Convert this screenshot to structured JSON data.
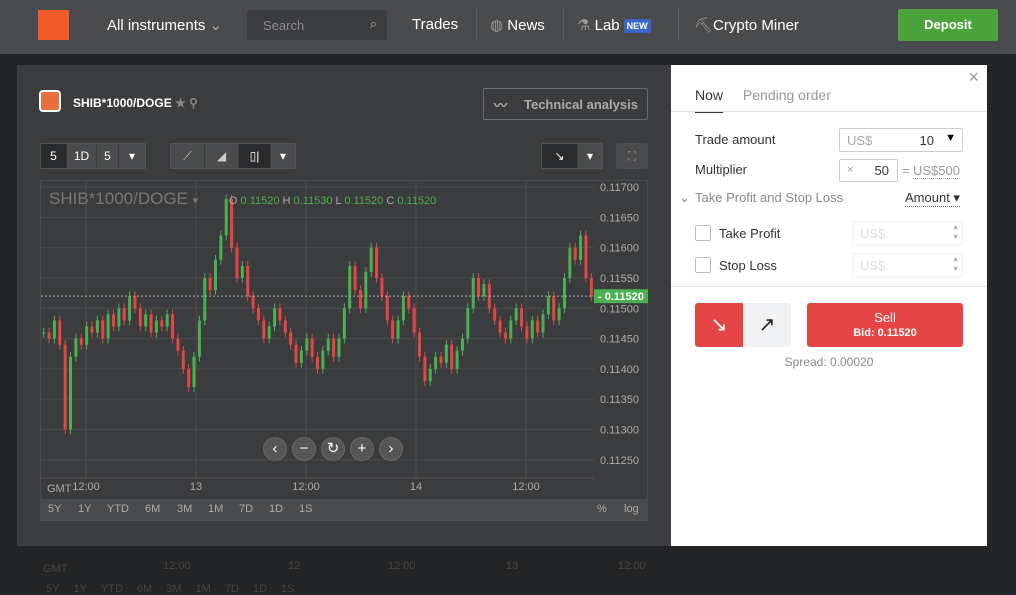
{
  "topbar": {
    "instruments": "All instruments",
    "search_placeholder": "Search",
    "trades": "Trades",
    "news": "News",
    "lab": "Lab",
    "lab_badge": "NEW",
    "crypto": "Crypto Miner",
    "deposit": "Deposit"
  },
  "background_axis": {
    "gmt": "GMT",
    "ticks": [
      "12:00",
      "12",
      "12:00",
      "13",
      "12:00"
    ],
    "ranges": [
      "5Y",
      "1Y",
      "YTD",
      "6M",
      "3M",
      "1M",
      "7D",
      "1D",
      "1S"
    ]
  },
  "chart_panel": {
    "symbol": "SHIB*1000/DOGE",
    "technical_analysis": "Technical analysis",
    "period_buttons": [
      "5",
      "1D",
      "5"
    ],
    "legend_symbol": "SHIB*1000/DOGE",
    "ohlc": {
      "O": "0.11520",
      "H": "0.11530",
      "L": "0.11520",
      "C": "0.11520"
    },
    "ranges": [
      "5Y",
      "1Y",
      "YTD",
      "6M",
      "3M",
      "1M",
      "7D",
      "1D",
      "1S"
    ],
    "percent": "%",
    "log": "log",
    "gmt": "GMT"
  },
  "chart_data": {
    "type": "candlestick",
    "ylim": [
      0.1122,
      0.1171
    ],
    "yticks": [
      "0.11700",
      "0.11650",
      "0.11600",
      "0.11550",
      "0.11500",
      "0.11450",
      "0.11400",
      "0.11350",
      "0.11300",
      "0.11250"
    ],
    "ytick_values": [
      0.117,
      0.1165,
      0.116,
      0.1155,
      0.115,
      0.1145,
      0.114,
      0.1135,
      0.113,
      0.1125
    ],
    "xticks": [
      "12:00",
      "13",
      "12:00",
      "14",
      "12:00"
    ],
    "current_price": "0.11520",
    "current_value": 0.1152,
    "closes": [
      0.1146,
      0.1145,
      0.1148,
      0.1144,
      0.113,
      0.1142,
      0.1145,
      0.1144,
      0.1147,
      0.1146,
      0.1148,
      0.1145,
      0.1149,
      0.1147,
      0.115,
      0.1148,
      0.1152,
      0.115,
      0.1147,
      0.1149,
      0.1146,
      0.1148,
      0.1147,
      0.1149,
      0.1145,
      0.1143,
      0.114,
      0.1137,
      0.1142,
      0.1148,
      0.1155,
      0.1153,
      0.1158,
      0.1162,
      0.1168,
      0.116,
      0.1155,
      0.1157,
      0.1152,
      0.115,
      0.1148,
      0.1145,
      0.1147,
      0.115,
      0.1148,
      0.1146,
      0.1144,
      0.1141,
      0.1143,
      0.1145,
      0.1142,
      0.114,
      0.1143,
      0.1145,
      0.1142,
      0.1145,
      0.115,
      0.1157,
      0.1153,
      0.115,
      0.1156,
      0.116,
      0.1155,
      0.1152,
      0.1148,
      0.1145,
      0.1148,
      0.1152,
      0.115,
      0.1146,
      0.1142,
      0.1138,
      0.114,
      0.1142,
      0.1141,
      0.1144,
      0.114,
      0.1143,
      0.1145,
      0.115,
      0.1155,
      0.1152,
      0.1154,
      0.115,
      0.1148,
      0.1146,
      0.1145,
      0.1148,
      0.115,
      0.1147,
      0.1145,
      0.1148,
      0.1146,
      0.1149,
      0.1152,
      0.1148,
      0.115,
      0.1155,
      0.116,
      0.1158,
      0.1162,
      0.1155,
      0.1152
    ]
  },
  "trade": {
    "tab_now": "Now",
    "tab_pending": "Pending order",
    "amount_label": "Trade amount",
    "amount_currency": "US$",
    "amount_value": "10",
    "multiplier_label": "Multiplier",
    "multiplier_x": "×",
    "multiplier_value": "50",
    "multiplier_eq": "=",
    "multiplier_total": "US$500",
    "tpsl_label": "Take Profit and Stop Loss",
    "tpsl_mode": "Amount",
    "take_profit": "Take Profit",
    "stop_loss": "Stop Loss",
    "tp_placeholder": "US$",
    "sl_placeholder": "US$",
    "sell": "Sell",
    "bid": "Bid: 0.11520",
    "spread": "Spread: 0.00020"
  },
  "colors": {
    "up": "#4caf50",
    "down": "#e64545",
    "deposit": "#4ca33b"
  }
}
